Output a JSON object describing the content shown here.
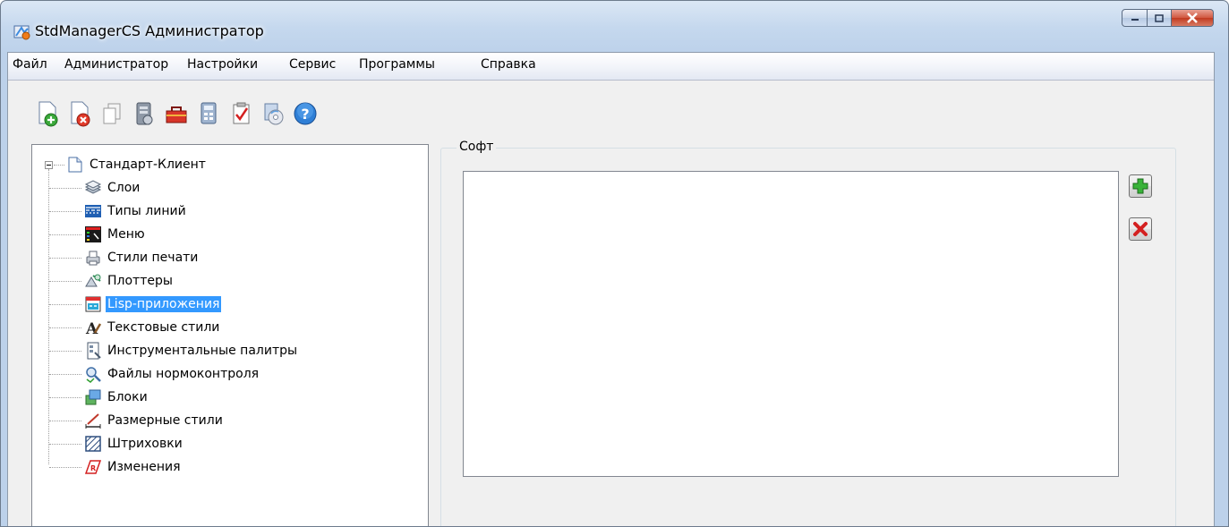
{
  "window": {
    "title": "StdManagerCS Администратор"
  },
  "menu": {
    "items": [
      "Файл",
      "Администратор",
      "Настройки",
      "Сервис",
      "Программы",
      "Справка"
    ]
  },
  "toolbar": {
    "buttons": [
      "new-document-icon",
      "delete-document-icon",
      "copy-icon",
      "server-icon",
      "toolbox-icon",
      "calculator-icon",
      "checklist-icon",
      "install-disc-icon",
      "help-icon"
    ]
  },
  "tree": {
    "root_label": "Стандарт-Клиент",
    "items": [
      {
        "label": "Слои",
        "icon": "layers-icon"
      },
      {
        "label": "Типы линий",
        "icon": "linetypes-icon"
      },
      {
        "label": "Меню",
        "icon": "menu-icon"
      },
      {
        "label": "Стили печати",
        "icon": "print-styles-icon"
      },
      {
        "label": "Плоттеры",
        "icon": "plotter-icon"
      },
      {
        "label": "Lisp-приложения",
        "icon": "lisp-app-icon"
      },
      {
        "label": "Текстовые стили",
        "icon": "text-style-icon"
      },
      {
        "label": "Инструментальные палитры",
        "icon": "tool-palette-icon"
      },
      {
        "label": "Файлы нормоконтроля",
        "icon": "standards-check-icon"
      },
      {
        "label": "Блоки",
        "icon": "blocks-icon"
      },
      {
        "label": "Размерные стили",
        "icon": "dimension-style-icon"
      },
      {
        "label": "Штриховки",
        "icon": "hatch-icon"
      },
      {
        "label": "Изменения",
        "icon": "changes-icon"
      }
    ],
    "selected": "Lisp-приложения"
  },
  "content": {
    "group_title": "Софт"
  },
  "colors": {
    "selection": "#3399ff",
    "add": "#2e9e2e",
    "remove": "#d42020"
  }
}
